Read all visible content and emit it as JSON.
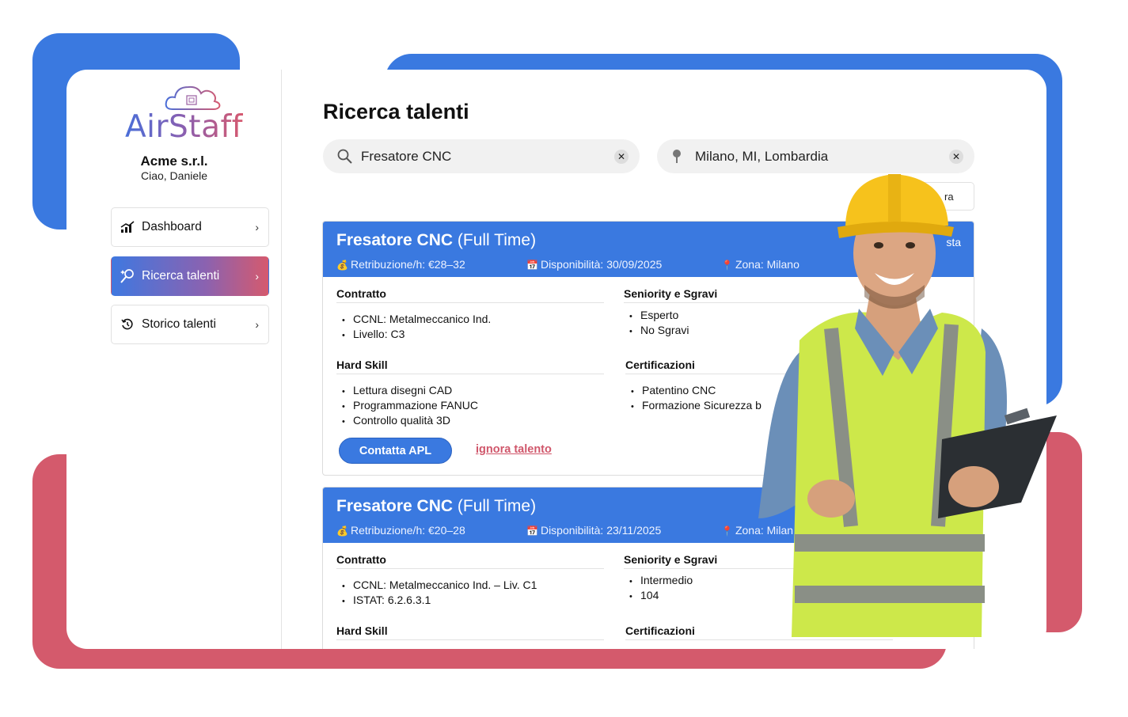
{
  "brand": {
    "name": "AirStaff",
    "gradient_colors": [
      "#4a6ed8",
      "#8a5fb0",
      "#d65a70"
    ]
  },
  "account": {
    "company": "Acme s.r.l.",
    "greeting": "Ciao, Daniele"
  },
  "sidebar": {
    "items": [
      {
        "label": "Dashboard",
        "icon": "chart-bars-icon",
        "active": false
      },
      {
        "label": "Ricerca talenti",
        "icon": "wand-search-icon",
        "active": true
      },
      {
        "label": "Storico talenti",
        "icon": "history-icon",
        "active": false
      }
    ]
  },
  "main": {
    "title": "Ricerca talenti",
    "search_role": {
      "value": "Fresatore CNC",
      "icon": "search-icon"
    },
    "search_location": {
      "value": "Milano, MI, Lombardia",
      "icon": "pin-icon"
    },
    "filter_label": "ra"
  },
  "cards": [
    {
      "title": "Fresatore CNC",
      "type": "(Full Time)",
      "pay": "Retribuzione/h: €28–32",
      "availability": "Disponibilità: 30/09/2025",
      "zone": "Zona: Milano",
      "corner": "sta",
      "contract_title": "Contratto",
      "contract": [
        "CCNL: Metalmeccanico Ind.",
        "Livello: C3"
      ],
      "seniority_title": "Seniority e Sgravi",
      "seniority": [
        "Esperto",
        "No Sgravi"
      ],
      "hard_title": "Hard Skill",
      "hard": [
        "Lettura disegni CAD",
        "Programmazione FANUC",
        "Controllo qualità 3D"
      ],
      "cert_title": "Certificazioni",
      "cert": [
        "Patentino CNC",
        "Formazione Sicurezza b"
      ],
      "contact_label": "Contatta APL",
      "ignore_label": "ignora talento"
    },
    {
      "title": "Fresatore CNC",
      "type": "(Full Time)",
      "pay": "Retribuzione/h: €20–28",
      "availability": "Disponibilità: 23/11/2025",
      "zone": "Zona: Milan",
      "contract_title": "Contratto",
      "contract": [
        "CCNL: Metalmeccanico Ind. – Liv. C1",
        "ISTAT: 6.2.6.3.1"
      ],
      "seniority_title": "Seniority e Sgravi",
      "seniority": [
        "Intermedio",
        "104"
      ],
      "hard_title": "Hard Skill",
      "cert_title": "Certificazioni"
    }
  ],
  "colors": {
    "primary_blue": "#3a79e0",
    "accent_red": "#d45a6c",
    "link_red": "#d0576b"
  }
}
